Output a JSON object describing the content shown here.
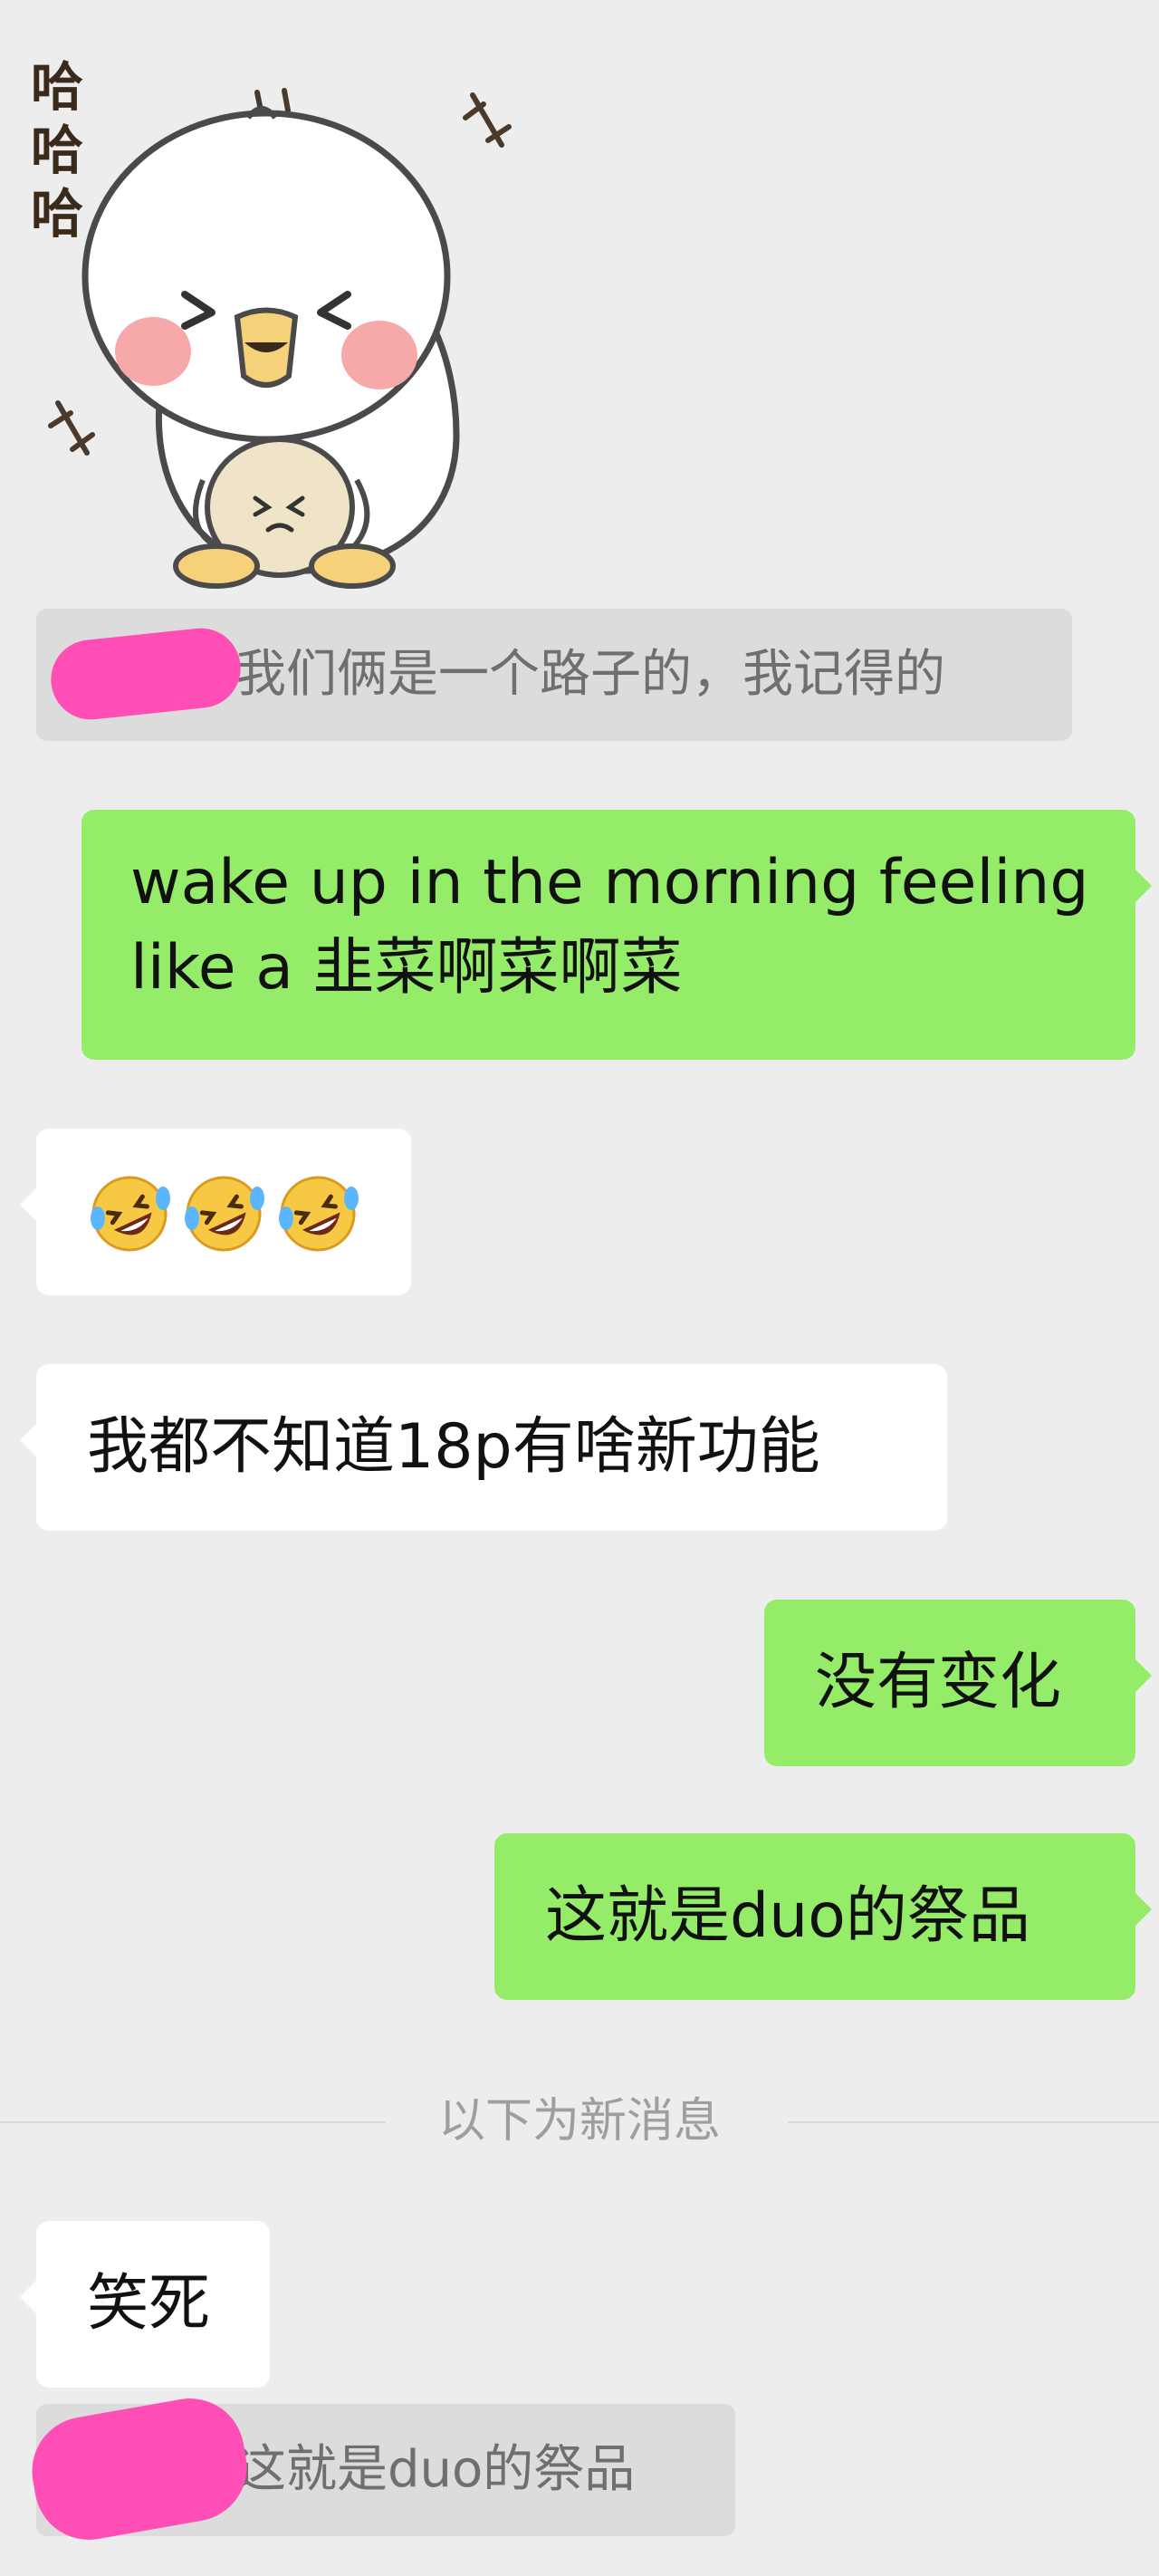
{
  "sticker": {
    "text": "哈哈哈",
    "icon": "laughing-duck-sticker"
  },
  "messages": [
    {
      "id": "quote-1",
      "type": "quote",
      "text": "我们俩是一个路子的，我记得的"
    },
    {
      "id": "out-1",
      "type": "outgoing",
      "line1": "wake up in the morning feeling",
      "line2": "like a 韭菜啊菜啊菜"
    },
    {
      "id": "in-emoji",
      "type": "incoming",
      "emoji": [
        "rolling-on-floor-laughing-emoji",
        "rolling-on-floor-laughing-emoji",
        "rolling-on-floor-laughing-emoji"
      ]
    },
    {
      "id": "in-2",
      "type": "incoming",
      "text": "我都不知道18p有啥新功能"
    },
    {
      "id": "out-2",
      "type": "outgoing",
      "text": "没有变化"
    },
    {
      "id": "out-3",
      "type": "outgoing",
      "text": "这就是duo的祭品"
    },
    {
      "id": "in-3",
      "type": "incoming",
      "text": "笑死"
    },
    {
      "id": "quote-2",
      "type": "quote",
      "text": "这就是duo的祭品"
    }
  ],
  "divider": {
    "label": "以下为新消息"
  },
  "colors": {
    "background": "#ededed",
    "outgoing_bubble": "#95ec69",
    "incoming_bubble": "#ffffff",
    "quote_bg": "#dcdcdc",
    "redaction": "#ff4fb6"
  }
}
